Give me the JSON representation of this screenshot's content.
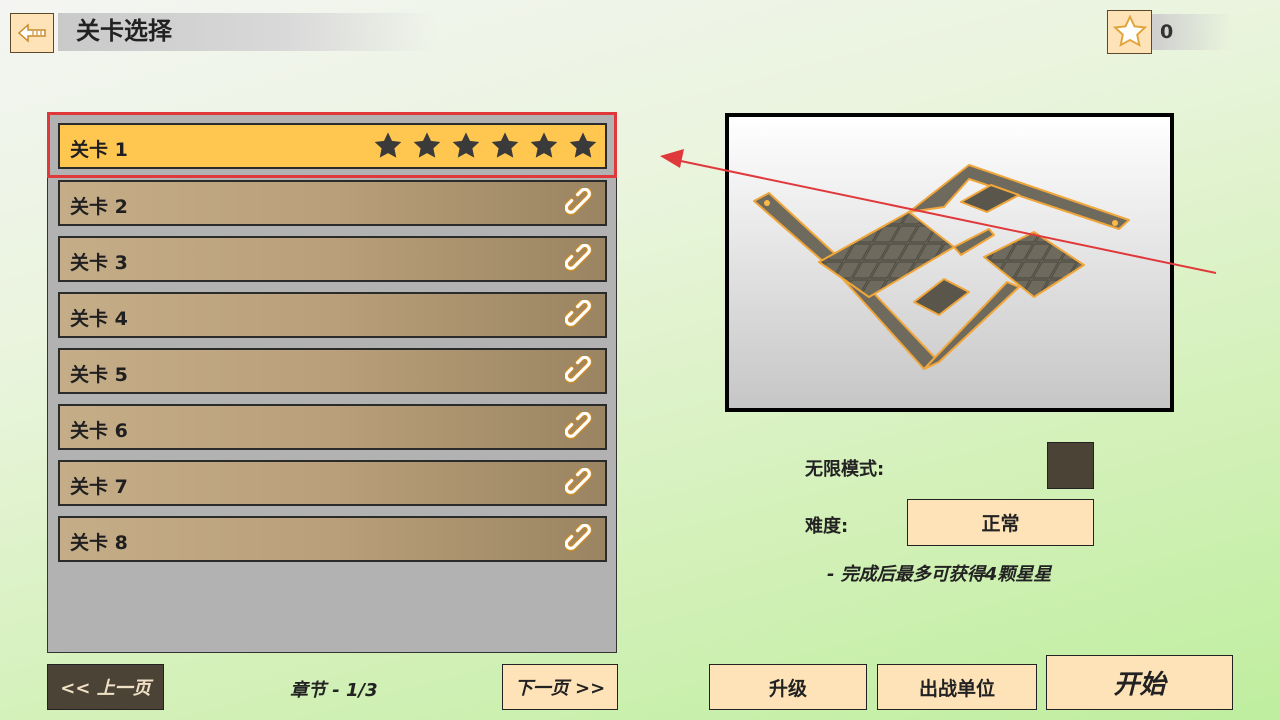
{
  "header": {
    "title": "关卡选择",
    "back_icon": "back-arrow-icon",
    "star_count": "0"
  },
  "levels": [
    {
      "label": "关卡 1",
      "state": "unlocked",
      "stars": 6,
      "selected": true
    },
    {
      "label": "关卡 2",
      "state": "locked"
    },
    {
      "label": "关卡 3",
      "state": "locked"
    },
    {
      "label": "关卡 4",
      "state": "locked"
    },
    {
      "label": "关卡 5",
      "state": "locked"
    },
    {
      "label": "关卡 6",
      "state": "locked"
    },
    {
      "label": "关卡 7",
      "state": "locked"
    },
    {
      "label": "关卡 8",
      "state": "locked"
    }
  ],
  "options": {
    "endless_label": "无限模式:",
    "difficulty_label": "难度:",
    "difficulty_value": "正常",
    "difficulty_hint": "- 完成后最多可获得4颗星星"
  },
  "footer": {
    "prev_label": "<< 上一页",
    "chapter_label": "章节 - 1/3",
    "next_label": "下一页 >>",
    "upgrade_label": "升级",
    "units_label": "出战单位",
    "start_label": "开始"
  },
  "colors": {
    "selected_row": "#ffc74f",
    "locked_row": "#b9a07a",
    "button": "#ffe3b8",
    "annotation": "#e0393c"
  }
}
